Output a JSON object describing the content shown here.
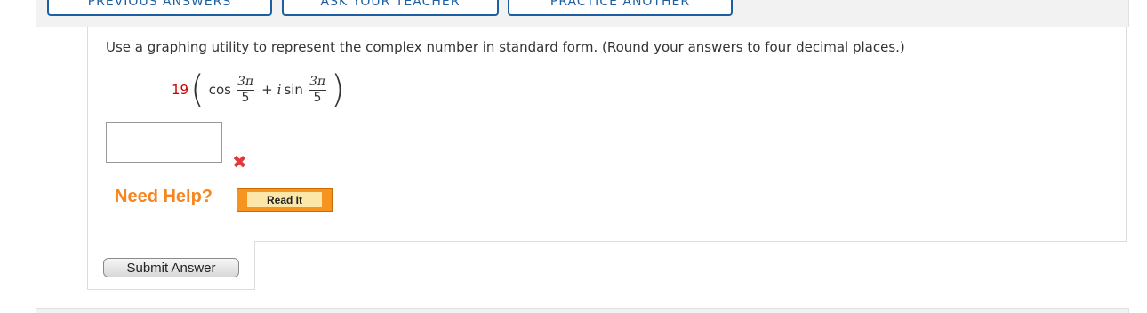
{
  "toolbar": {
    "previous_answers": "PREVIOUS ANSWERS",
    "ask_your_teacher": "ASK YOUR TEACHER",
    "practice_another": "PRACTICE ANOTHER"
  },
  "question": {
    "text": "Use a graphing utility to represent the complex number in standard form. (Round your answers to four decimal places.)",
    "coefficient": "19",
    "cos": "cos",
    "sin": "sin",
    "imag_unit": "i",
    "plus": "+",
    "frac_num": "3π",
    "frac_den": "5"
  },
  "answer": {
    "value": "",
    "status_icon": "wrong-x-icon",
    "status_color": "#e0393e"
  },
  "help": {
    "label": "Need Help?",
    "read_it": "Read It"
  },
  "actions": {
    "submit": "Submit Answer"
  },
  "colors": {
    "accent_blue": "#1d5fa1",
    "help_orange": "#f5861f",
    "coefficient_red": "#cc0000"
  }
}
